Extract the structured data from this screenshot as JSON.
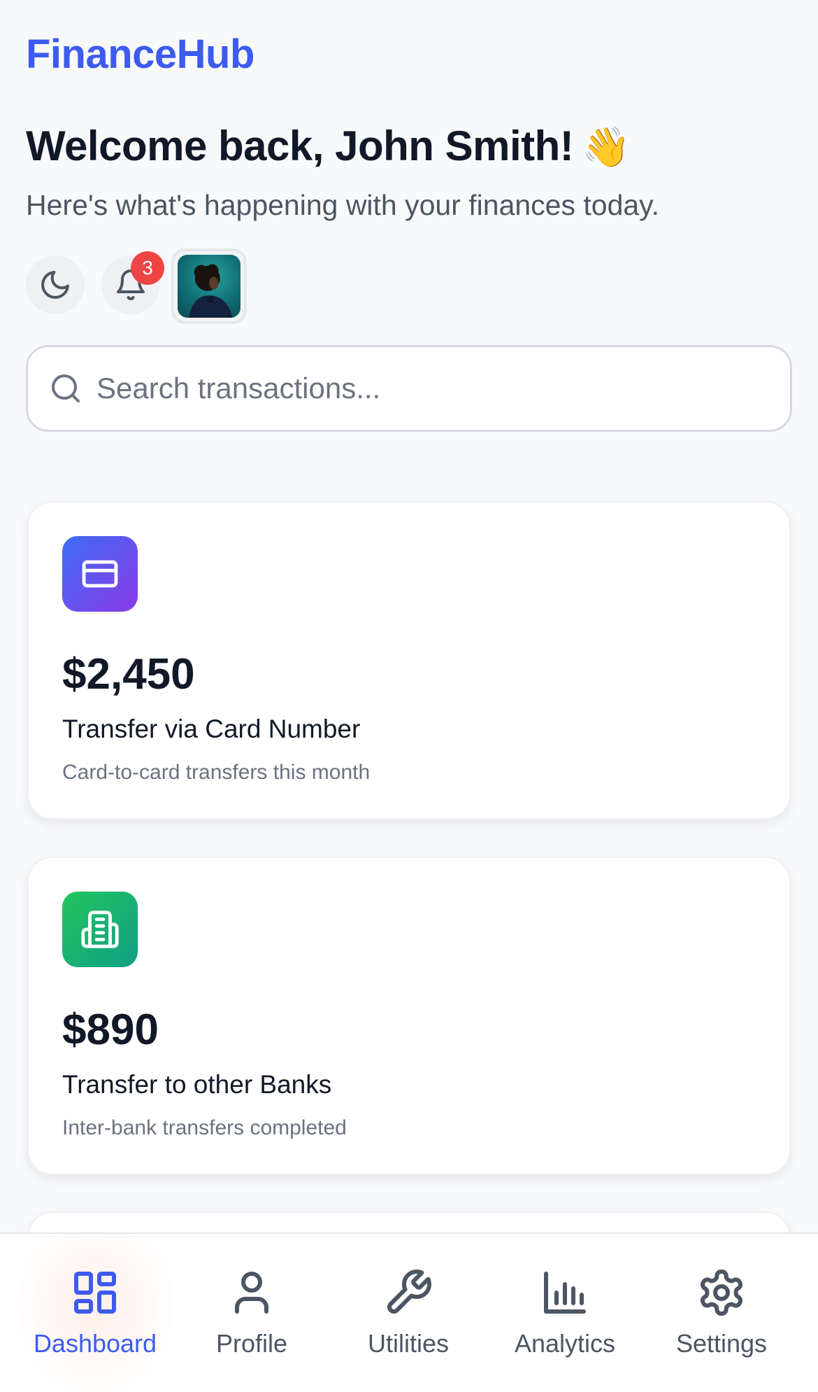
{
  "app": {
    "brand": "FinanceHub"
  },
  "header": {
    "welcome": "Welcome back, John Smith!",
    "wave_emoji": "👋",
    "subtitle": "Here's what's happening with your finances today."
  },
  "controls": {
    "theme_icon": "moon-icon",
    "notification_icon": "bell-icon",
    "notification_count": "3",
    "avatar": "user-avatar"
  },
  "search": {
    "placeholder": "Search transactions...",
    "value": ""
  },
  "cards": [
    {
      "icon": "credit-card-icon",
      "amount": "$2,450",
      "title": "Transfer via Card Number",
      "description": "Card-to-card transfers this month",
      "gradient": [
        "#3d6cf3",
        "#8b3ae8"
      ]
    },
    {
      "icon": "bank-building-icon",
      "amount": "$890",
      "title": "Transfer to other Banks",
      "description": "Inter-bank transfers completed",
      "gradient": [
        "#22c55e",
        "#119e84"
      ]
    }
  ],
  "nav": {
    "items": [
      {
        "label": "Dashboard",
        "icon": "dashboard-grid-icon",
        "active": true
      },
      {
        "label": "Profile",
        "icon": "user-icon",
        "active": false
      },
      {
        "label": "Utilities",
        "icon": "wrench-icon",
        "active": false
      },
      {
        "label": "Analytics",
        "icon": "bar-chart-icon",
        "active": false
      },
      {
        "label": "Settings",
        "icon": "gear-icon",
        "active": false
      }
    ]
  },
  "colors": {
    "accent": "#3d5af1",
    "badge": "#ef4444",
    "text_primary": "#111827",
    "text_muted": "#6b7280"
  }
}
